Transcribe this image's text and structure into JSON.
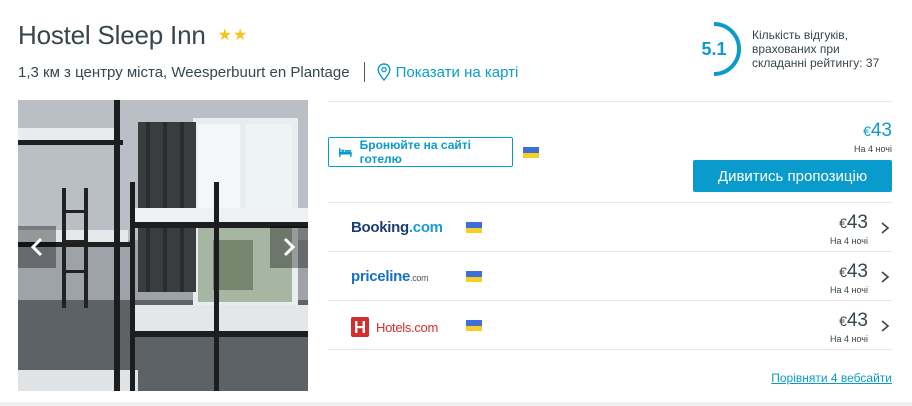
{
  "hotel": {
    "name": "Hostel Sleep Inn",
    "stars": [
      "★",
      "★"
    ],
    "location": "1,3 км з центру міста, Weesperbuurt en Plantage",
    "map_link": "Показати на карті"
  },
  "rating": {
    "value": "5.1",
    "description": "Кількість відгуків, врахованих при складанні рейтингу: 37"
  },
  "gallery": {
    "prev_icon": "chevron-left-icon",
    "next_icon": "chevron-right-icon"
  },
  "booking": {
    "button_label": "Бронюйте на сайті готелю",
    "price_currency": "€",
    "price_value": "43",
    "nights": "На 4 ночі",
    "deal_button": "Дивитись пропозицію"
  },
  "providers": [
    {
      "name_part1": "Booking",
      "name_part2": ".com",
      "currency": "€",
      "price": "43",
      "nights": "На 4 ночі"
    },
    {
      "name_part1": "priceline",
      "name_part2": ".com",
      "currency": "€",
      "price": "43",
      "nights": "На 4 ночі"
    },
    {
      "name_part1": "Hotels.com",
      "name_part2": "",
      "currency": "€",
      "price": "43",
      "nights": "На 4 ночі"
    }
  ],
  "compare_link": "Порівняти 4 вебсайти",
  "colors": {
    "accent": "#0a9bcd",
    "text": "#37454d",
    "star": "#f5c518",
    "flag_blue": "#3d6fd6",
    "flag_yellow": "#f5d024"
  }
}
